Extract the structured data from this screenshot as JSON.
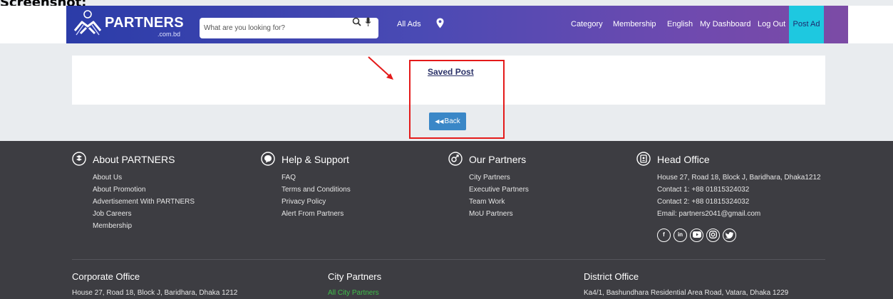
{
  "caption": "Screenshot:",
  "header": {
    "brand_name": "PARTNERS",
    "brand_sub": ".com.bd",
    "search_placeholder": "What are you looking for?",
    "all_ads": "All Ads",
    "nav_links": [
      "Category",
      "Membership",
      "English",
      "My Dashboard",
      "Log Out"
    ],
    "post_ad": "Post Ad"
  },
  "main": {
    "saved_post": "Saved Post",
    "back_icon": "◀◀",
    "back_label": "Back"
  },
  "footer": {
    "about": {
      "title": "About PARTNERS",
      "items": [
        "About Us",
        "About Promotion",
        "Advertisement With PARTNERS",
        "Job Careers",
        "Membership"
      ]
    },
    "help": {
      "title": "Help & Support",
      "items": [
        "FAQ",
        "Terms and Conditions",
        "Privacy Policy",
        "Alert From Partners"
      ]
    },
    "partners": {
      "title": "Our Partners",
      "items": [
        "City Partners",
        "Executive Partners",
        "Team Work",
        "MoU Partners"
      ]
    },
    "head_office": {
      "title": "Head Office",
      "items": [
        "House 27, Road 18, Block J, Baridhara, Dhaka1212",
        "Contact 1: +88 01815324032",
        "Contact 2: +88 01815324032",
        "Email: partners2041@gmail.com"
      ]
    },
    "social_icons": [
      "facebook-icon",
      "linkedin-icon",
      "youtube-icon",
      "instagram-icon",
      "twitter-icon"
    ],
    "corporate": {
      "title": "Corporate Office",
      "address": "House 27, Road 18, Block J, Baridhara, Dhaka 1212"
    },
    "city": {
      "title": "City Partners",
      "link": "All City Partners"
    },
    "district": {
      "title": "District Office",
      "address": "Ka4/1, Bashundhara Residential Area Road, Vatara, Dhaka 1229"
    }
  },
  "colors": {
    "accent": "#1ec8e0",
    "button": "#3a87c7",
    "annotation": "#e41a1a",
    "footer_bg": "#3d3d42",
    "link_green": "#3fbf4a"
  }
}
